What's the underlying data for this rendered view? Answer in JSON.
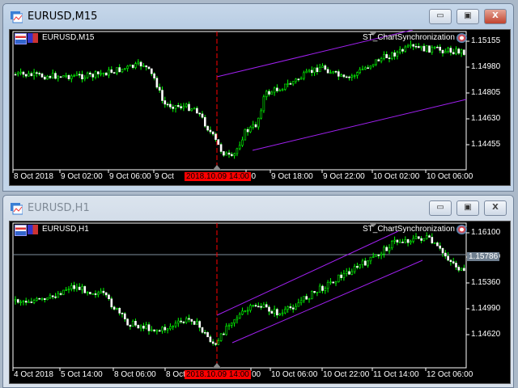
{
  "windows": [
    {
      "title": "EURUSD,M15",
      "chart_label": "EURUSD,M15",
      "indicator": "ST_ChartSynchronization",
      "price_labels": [
        "1.15155",
        "1.14980",
        "1.14805",
        "1.14630",
        "1.14455"
      ],
      "time_labels": [
        "8 Oct 2018",
        "9 Oct 02:00",
        "9 Oct 06:00",
        "9 Oct",
        "00",
        "9 Oct 18:00",
        "9 Oct 22:00",
        "10 Oct 02:00",
        "10 Oct 06:00"
      ],
      "crosshair_time": "2018.10.09 14:00",
      "active": true
    },
    {
      "title": "EURUSD,H1",
      "chart_label": "EURUSD,H1",
      "indicator": "ST_ChartSynchronization",
      "price_labels": [
        "1.16100",
        "1.15730",
        "1.15360",
        "1.14990",
        "1.14620"
      ],
      "current_price": "1.15786",
      "time_labels": [
        "4 Oct 2018",
        "5 Oct 14:00",
        "8 Oct 06:00",
        "8 Oct",
        "00",
        "10 Oct 06:00",
        "10 Oct 22:00",
        "11 Oct 14:00",
        "12 Oct 06:00"
      ],
      "crosshair_time": "2018.10.09 14:00",
      "active": false
    }
  ],
  "buttons": {
    "minimize": "▭",
    "restore": "▣",
    "close": "X"
  },
  "colors": {
    "bull": "#00ff00",
    "bear": "#ffffff",
    "channel": "#a020f0",
    "crosshair": "#ff0000"
  }
}
